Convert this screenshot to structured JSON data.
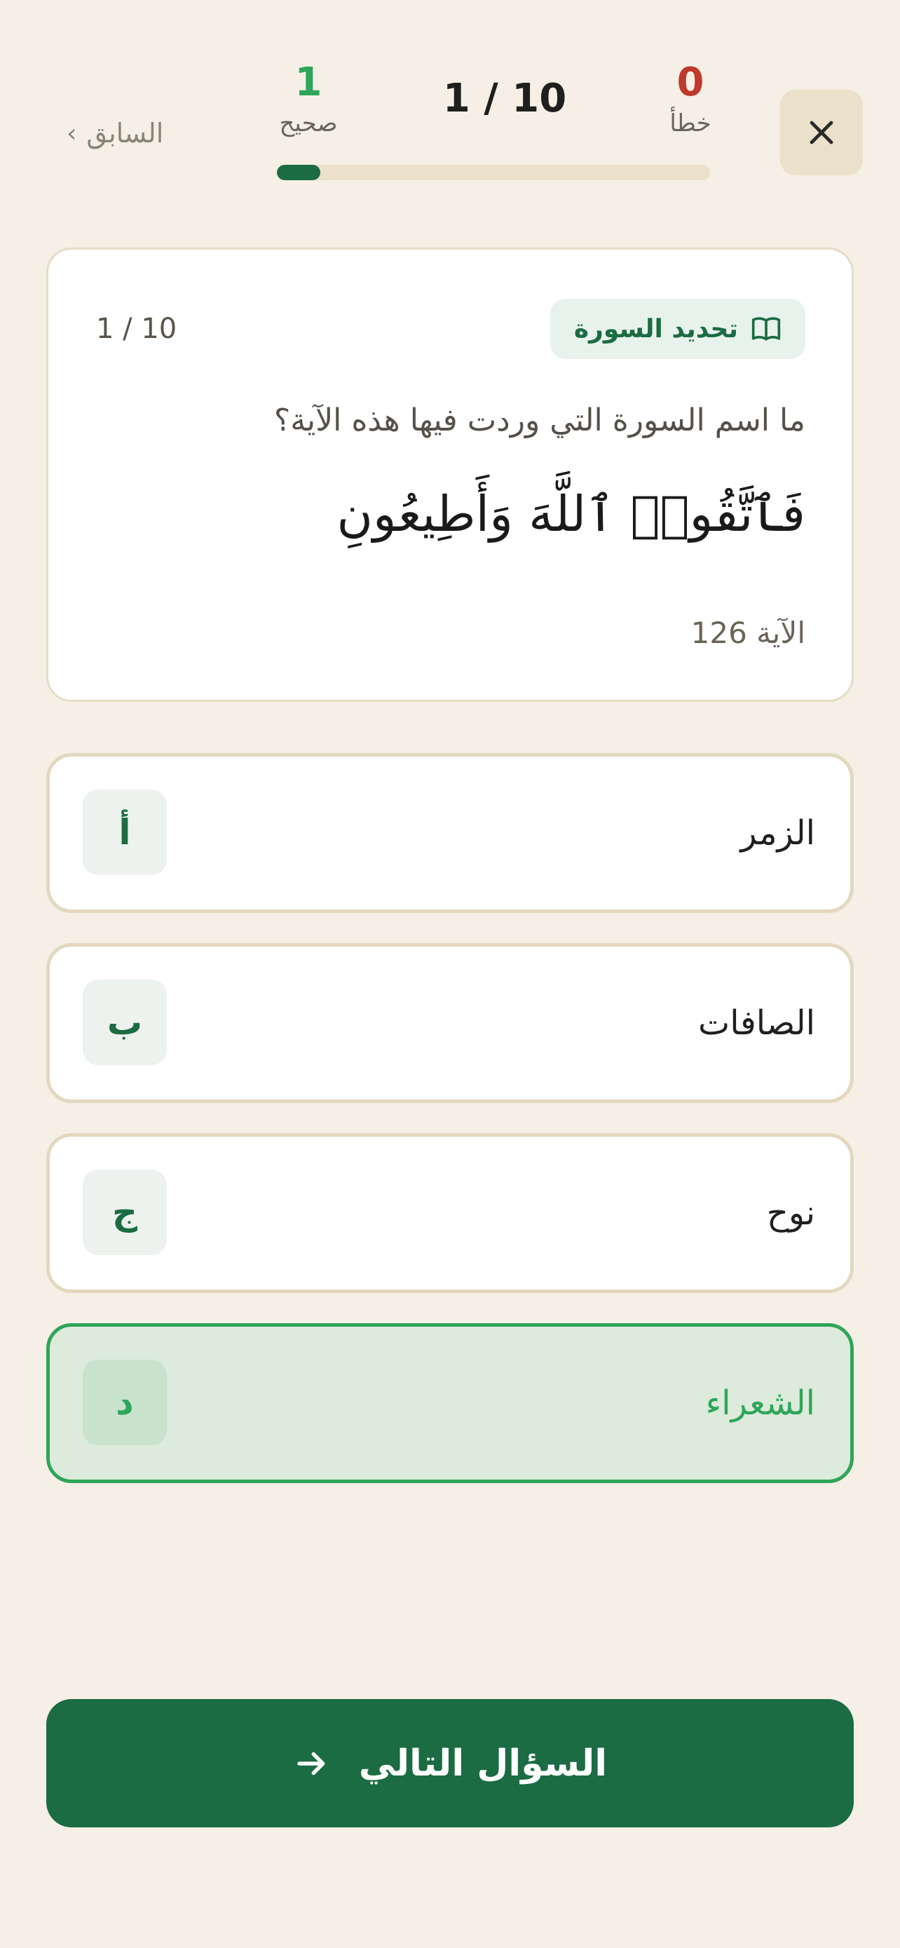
{
  "header": {
    "close_icon": "close-icon",
    "wrong_count": "0",
    "wrong_label": "خطأ",
    "correct_count": "1",
    "correct_label": "صحيح",
    "counter": "1 / 10",
    "prev_label": "السابق",
    "progress": 0.1,
    "colors": {
      "wrong": "#c0392b",
      "correct": "#2ea55a",
      "accent": "#1b6b43"
    }
  },
  "question": {
    "counter": "1 / 10",
    "badge_label": "تحديد السورة",
    "badge_icon": "book-icon",
    "prompt": "ما اسم السورة التي وردت فيها هذه الآية؟",
    "verse": "فَٱتَّقُوا۟ ٱللَّهَ وَأَطِيعُونِ",
    "ayah_label": "الآية 126"
  },
  "options": [
    {
      "letter": "أ",
      "text": "الزمر",
      "state": "default"
    },
    {
      "letter": "ب",
      "text": "الصافات",
      "state": "default"
    },
    {
      "letter": "ج",
      "text": "نوح",
      "state": "default"
    },
    {
      "letter": "د",
      "text": "الشعراء",
      "state": "correct"
    }
  ],
  "footer": {
    "next_label": "السؤال التالي",
    "next_icon": "arrow-right-icon"
  }
}
